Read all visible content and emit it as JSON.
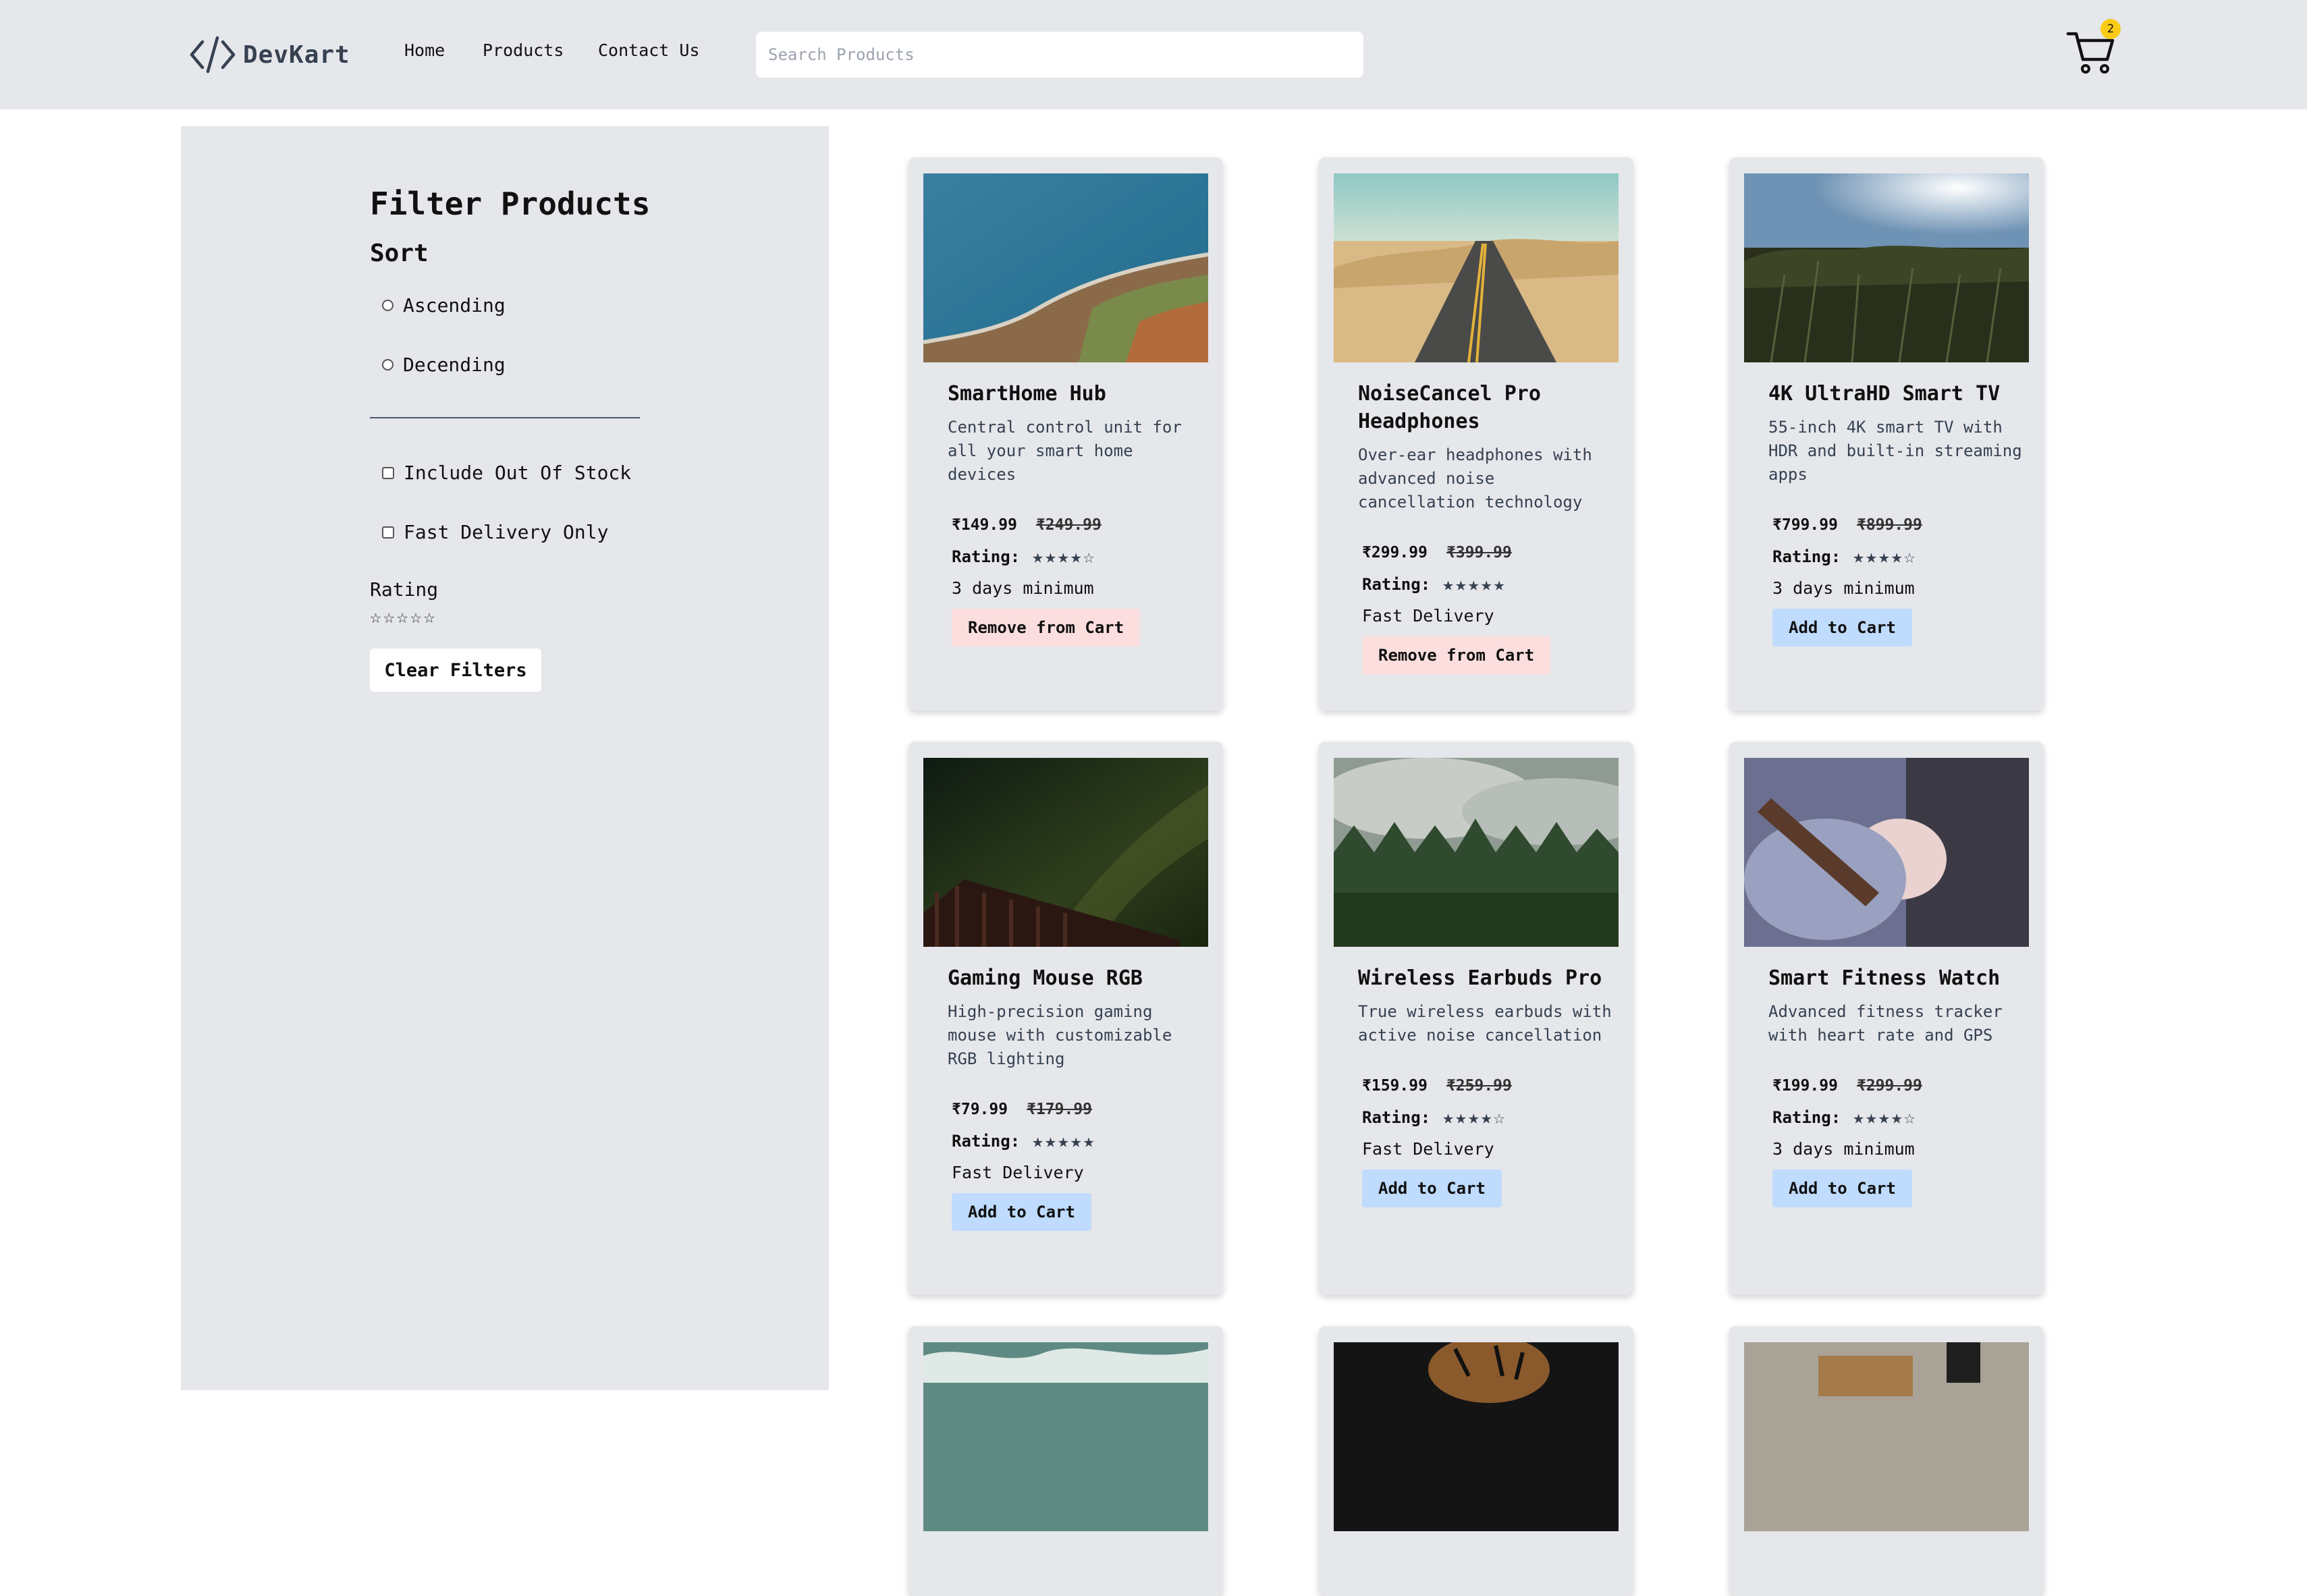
{
  "header": {
    "logo_text": "DevKart",
    "nav": [
      "Home",
      "Products",
      "Contact Us"
    ],
    "search_placeholder": "Search Products",
    "cart_count": "2"
  },
  "sidebar": {
    "title": "Filter Products",
    "sort_title": "Sort",
    "sort_options": [
      "Ascending",
      "Decending"
    ],
    "checkboxes": [
      "Include Out Of Stock",
      "Fast Delivery Only"
    ],
    "rating_label": "Rating",
    "clear_button": "Clear Filters"
  },
  "products": [
    {
      "title": "SmartHome Hub",
      "desc": "Central control unit for all your smart home devices",
      "price": "₹149.99",
      "old_price": "₹249.99",
      "rating_label": "Rating:",
      "rating": 4,
      "delivery": "3 days minimum",
      "button": "Remove from Cart",
      "in_cart": true
    },
    {
      "title": "NoiseCancel Pro Headphones",
      "desc": "Over-ear headphones with advanced noise cancellation technology",
      "price": "₹299.99",
      "old_price": "₹399.99",
      "rating_label": "Rating:",
      "rating": 5,
      "delivery": "Fast Delivery",
      "button": "Remove from Cart",
      "in_cart": true
    },
    {
      "title": "4K UltraHD Smart TV",
      "desc": "55-inch 4K smart TV with HDR and built-in streaming apps",
      "price": "₹799.99",
      "old_price": "₹899.99",
      "rating_label": "Rating:",
      "rating": 4,
      "delivery": "3 days minimum",
      "button": "Add to Cart",
      "in_cart": false
    },
    {
      "title": "Gaming Mouse RGB",
      "desc": "High-precision gaming mouse with customizable RGB lighting",
      "price": "₹79.99",
      "old_price": "₹179.99",
      "rating_label": "Rating:",
      "rating": 5,
      "delivery": "Fast Delivery",
      "button": "Add to Cart",
      "in_cart": false
    },
    {
      "title": "Wireless Earbuds Pro",
      "desc": "True wireless earbuds with active noise cancellation",
      "price": "₹159.99",
      "old_price": "₹259.99",
      "rating_label": "Rating:",
      "rating": 4,
      "delivery": "Fast Delivery",
      "button": "Add to Cart",
      "in_cart": false
    },
    {
      "title": "Smart Fitness Watch",
      "desc": "Advanced fitness tracker with heart rate and GPS",
      "price": "₹199.99",
      "old_price": "₹299.99",
      "rating_label": "Rating:",
      "rating": 4,
      "delivery": "3 days minimum",
      "button": "Add to Cart",
      "in_cart": false
    }
  ],
  "colors": {
    "header_bg": "#e5e7eb",
    "card_bg": "#e5e7eb",
    "remove_button": "#fcdede",
    "add_button": "#bfdbfe",
    "badge": "#facc15"
  }
}
